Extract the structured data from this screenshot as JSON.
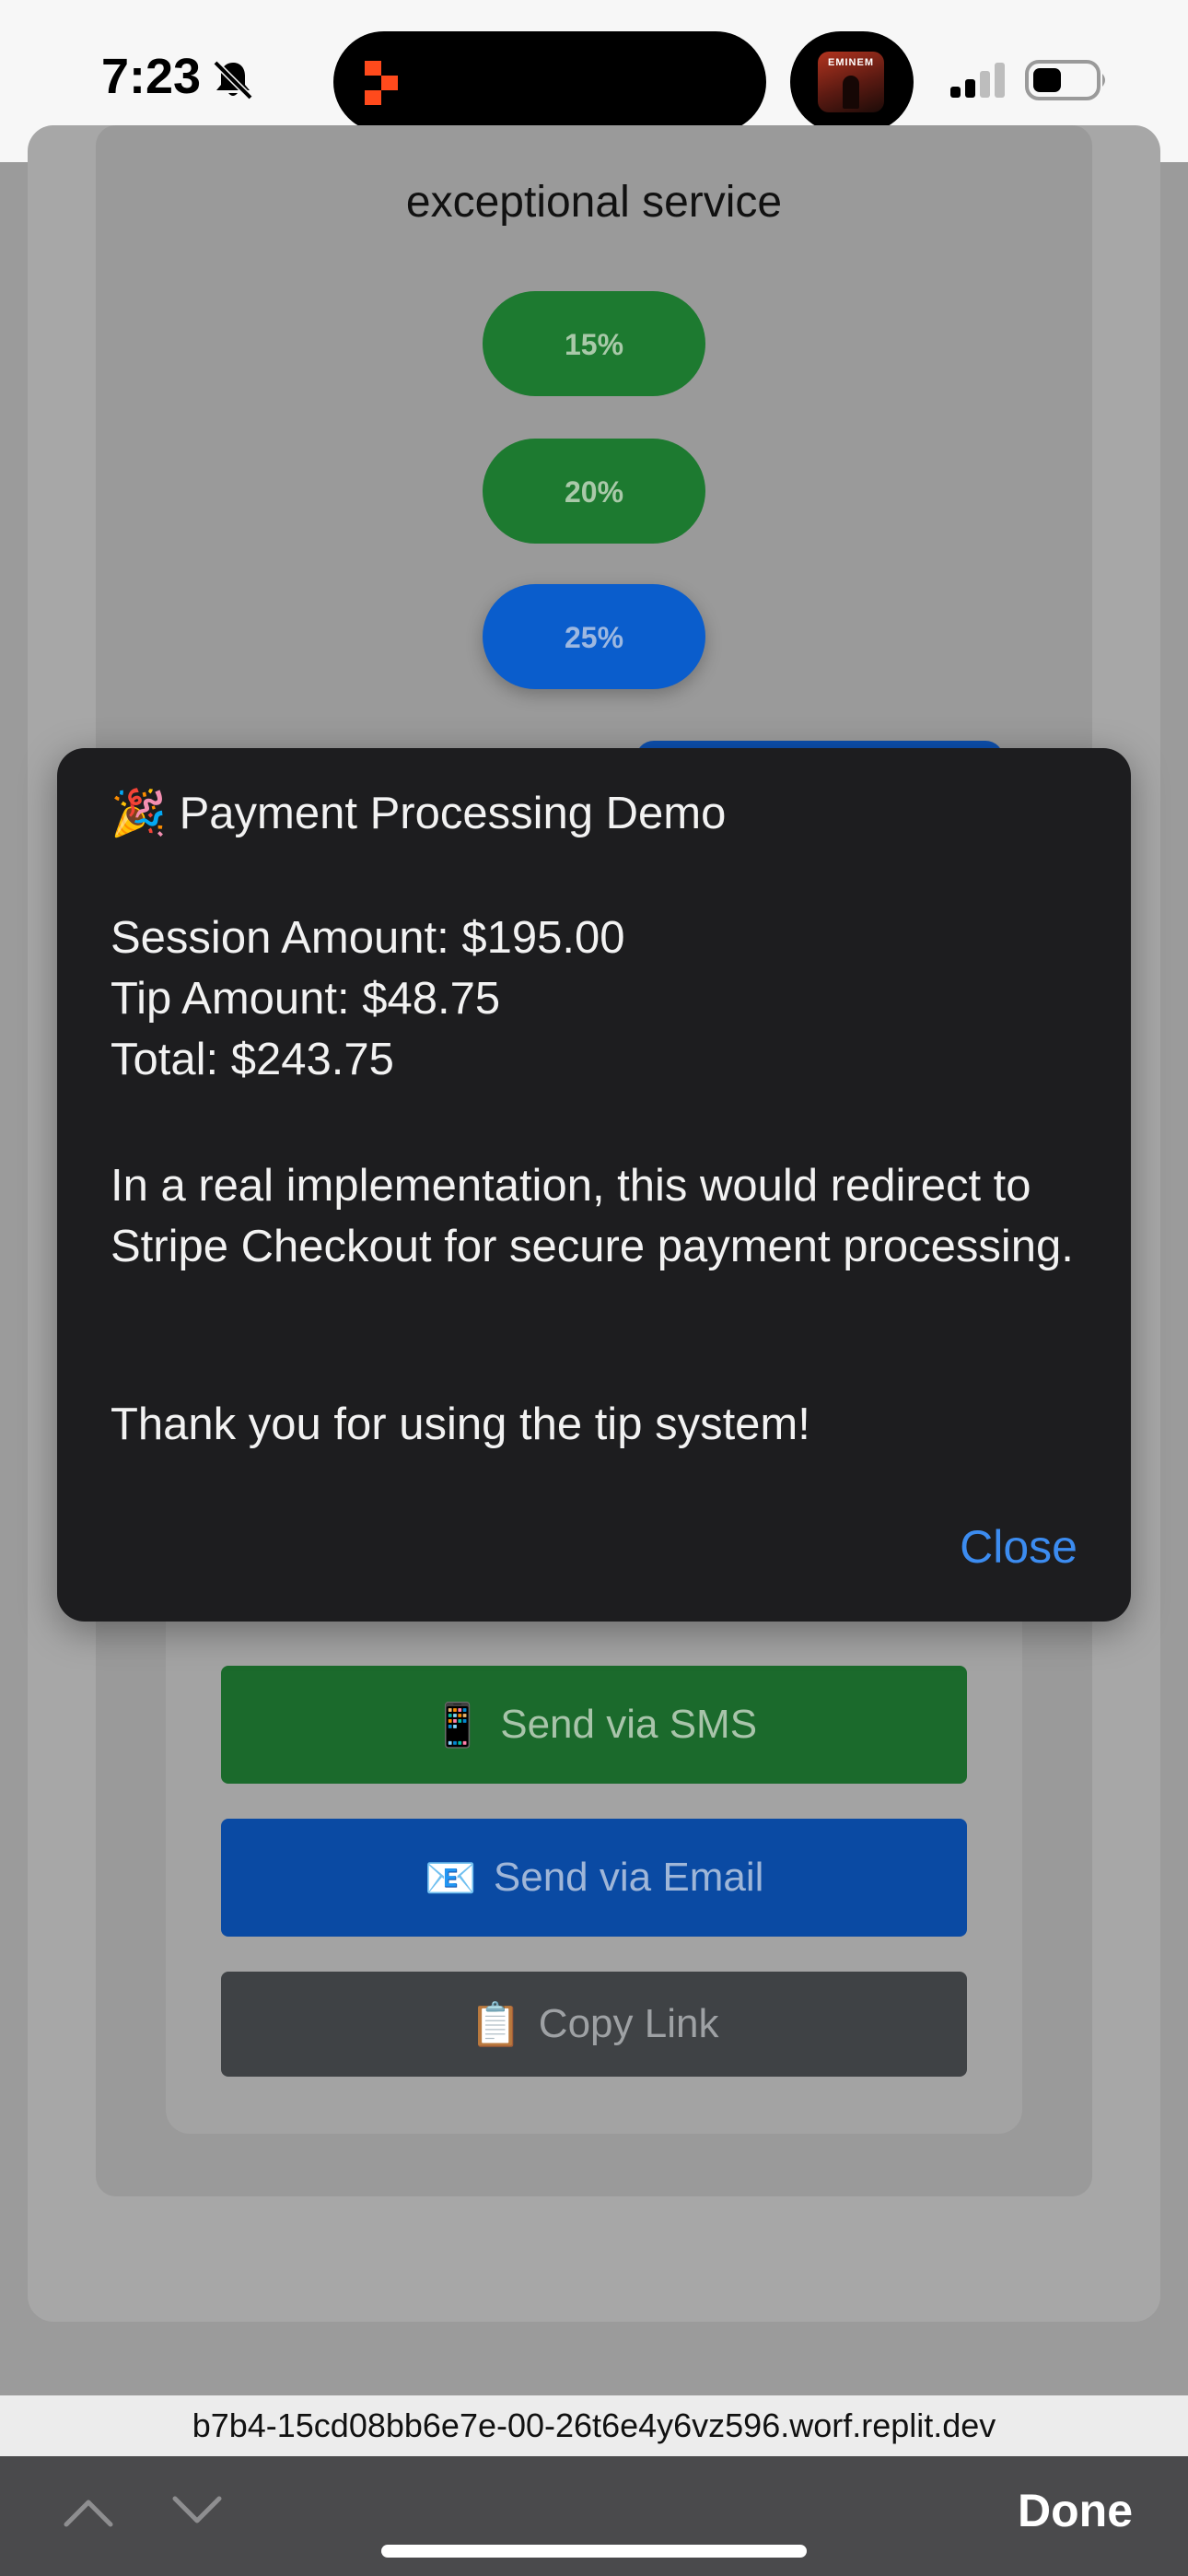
{
  "status_bar": {
    "time": "7:23",
    "album_label": "EMINEM"
  },
  "page": {
    "section_heading": "exceptional service",
    "tip_options": [
      {
        "label": "15%"
      },
      {
        "label": "20%"
      },
      {
        "label": "25%"
      }
    ],
    "selected_tip": "25%",
    "share_buttons": {
      "sms_icon": "📱",
      "sms_label": "Send via SMS",
      "email_icon": "📧",
      "email_label": "Send via Email",
      "copy_icon": "📋",
      "copy_label": "Copy Link"
    }
  },
  "dialog": {
    "title": "🎉 Payment Processing Demo",
    "session_amount": "Session Amount: $195.00",
    "tip_amount": "Tip Amount: $48.75",
    "total": "Total: $243.75",
    "message": "In a real implementation, this would redirect to Stripe Checkout for secure payment processing.",
    "thanks": "Thank you for using the tip system!",
    "close_label": "Close"
  },
  "browser": {
    "url": "b7b4-15cd08bb6e7e-00-26t6e4y6vz596.worf.replit.dev",
    "done_label": "Done"
  },
  "colors": {
    "accent_blue": "#3c8cf0",
    "green_button": "#1d7a30",
    "blue_button": "#0a5dcc",
    "dialog_bg": "#1d1d1f"
  }
}
